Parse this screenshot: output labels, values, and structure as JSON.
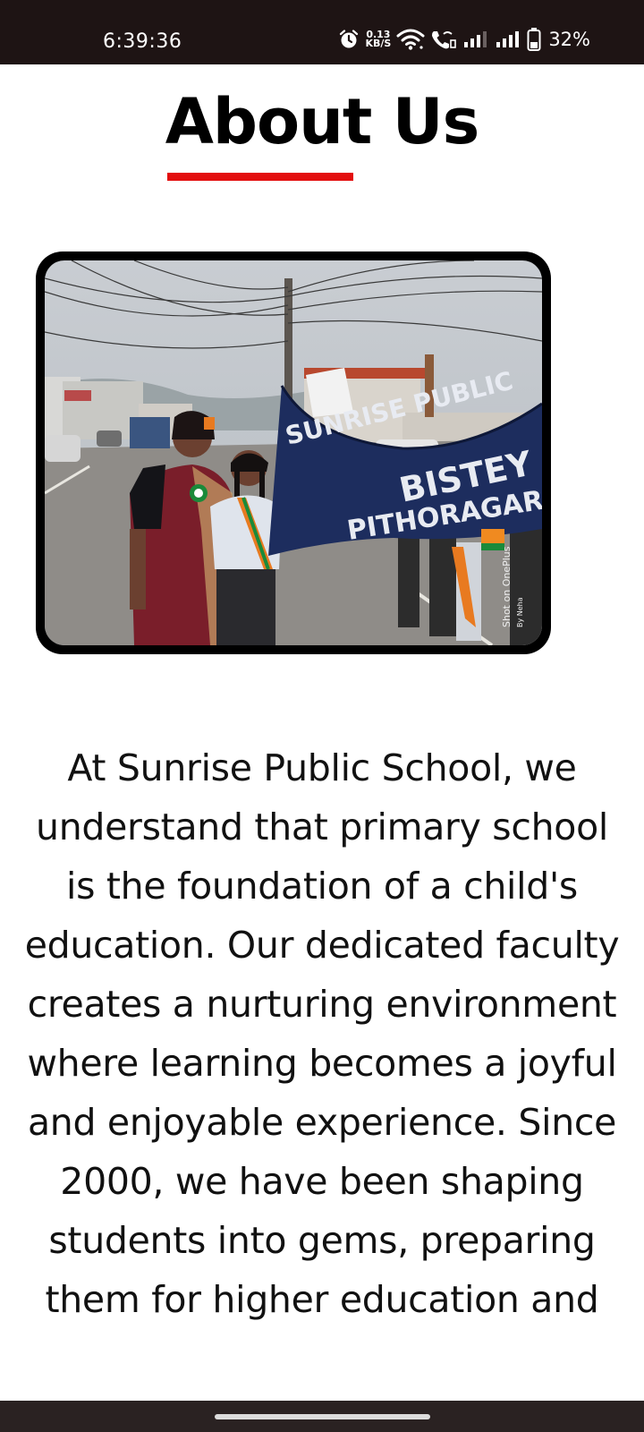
{
  "status_bar": {
    "time": "6:39:36",
    "net_speed_value": "0.13",
    "net_speed_unit": "KB/S",
    "battery_percent": "32%",
    "icons": [
      "alarm-icon",
      "wifi-icon",
      "wifi-call-icon",
      "signal-icon",
      "signal-icon-2",
      "battery-icon"
    ]
  },
  "main": {
    "title": "About Us",
    "accent_color": "#e30d0d",
    "photo": {
      "banner_line1": "SUNRISE PUBLIC",
      "banner_line2": "BISTEY",
      "banner_line3": "PITHORAGARH",
      "watermark_line1": "Shot on OnePlus",
      "watermark_line2": "By Neha"
    },
    "paragraph": "At Sunrise Public School, we understand that primary school is the foundation of a child's education. Our dedicated faculty creates a nurturing environment where learning becomes a joyful and enjoyable experience. Since 2000, we have been shaping students into gems, preparing them for higher education and"
  }
}
